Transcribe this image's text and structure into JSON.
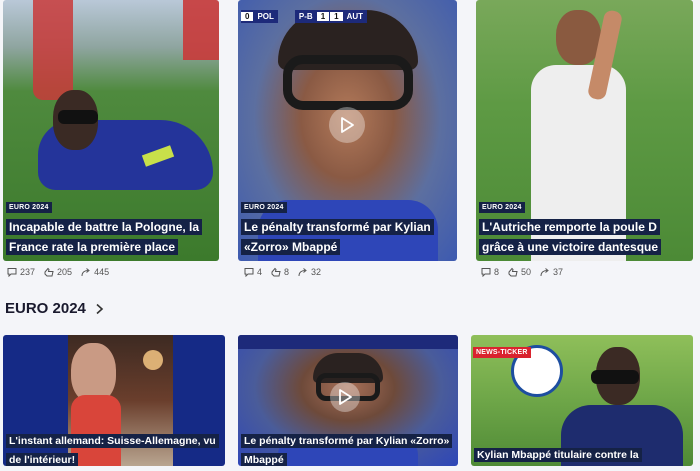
{
  "top_cards": [
    {
      "tag": "EURO 2024",
      "title": "Incapable de battre la Pologne, la France rate la première place",
      "stats": {
        "comments": "237",
        "likes": "205",
        "shares": "445"
      }
    },
    {
      "tag": "EURO 2024",
      "title": "Le pénalty transformé par Kylian «Zorro» Mbappé",
      "stats": {
        "comments": "4",
        "likes": "8",
        "shares": "32"
      },
      "scoreboard": {
        "home_score": "0",
        "home": "POL",
        "pen_label": "P-B",
        "score_a": "1",
        "score_b": "1",
        "away": "AUT"
      }
    },
    {
      "tag": "EURO 2024",
      "title": "L'Autriche remporte la poule D grâce à une victoire dantesque",
      "stats": {
        "comments": "8",
        "likes": "50",
        "shares": "37"
      }
    }
  ],
  "section": {
    "title": "EURO 2024"
  },
  "bottom_cards": [
    {
      "title": "L'instant allemand: Suisse-Allemagne, vu de l'intérieur!"
    },
    {
      "title": "Le pénalty transformé par Kylian «Zorro» Mbappé"
    },
    {
      "tag": "NEWS-TICKER",
      "title": "Kylian Mbappé titulaire contre la Pologne"
    }
  ],
  "colors": {
    "tag_bg": "#152246",
    "ticker_red": "#d9232e",
    "page_bg": "#f4f5f9"
  },
  "icons": [
    "comment-icon",
    "like-icon",
    "share-icon",
    "play-icon",
    "chevron-right-icon"
  ]
}
